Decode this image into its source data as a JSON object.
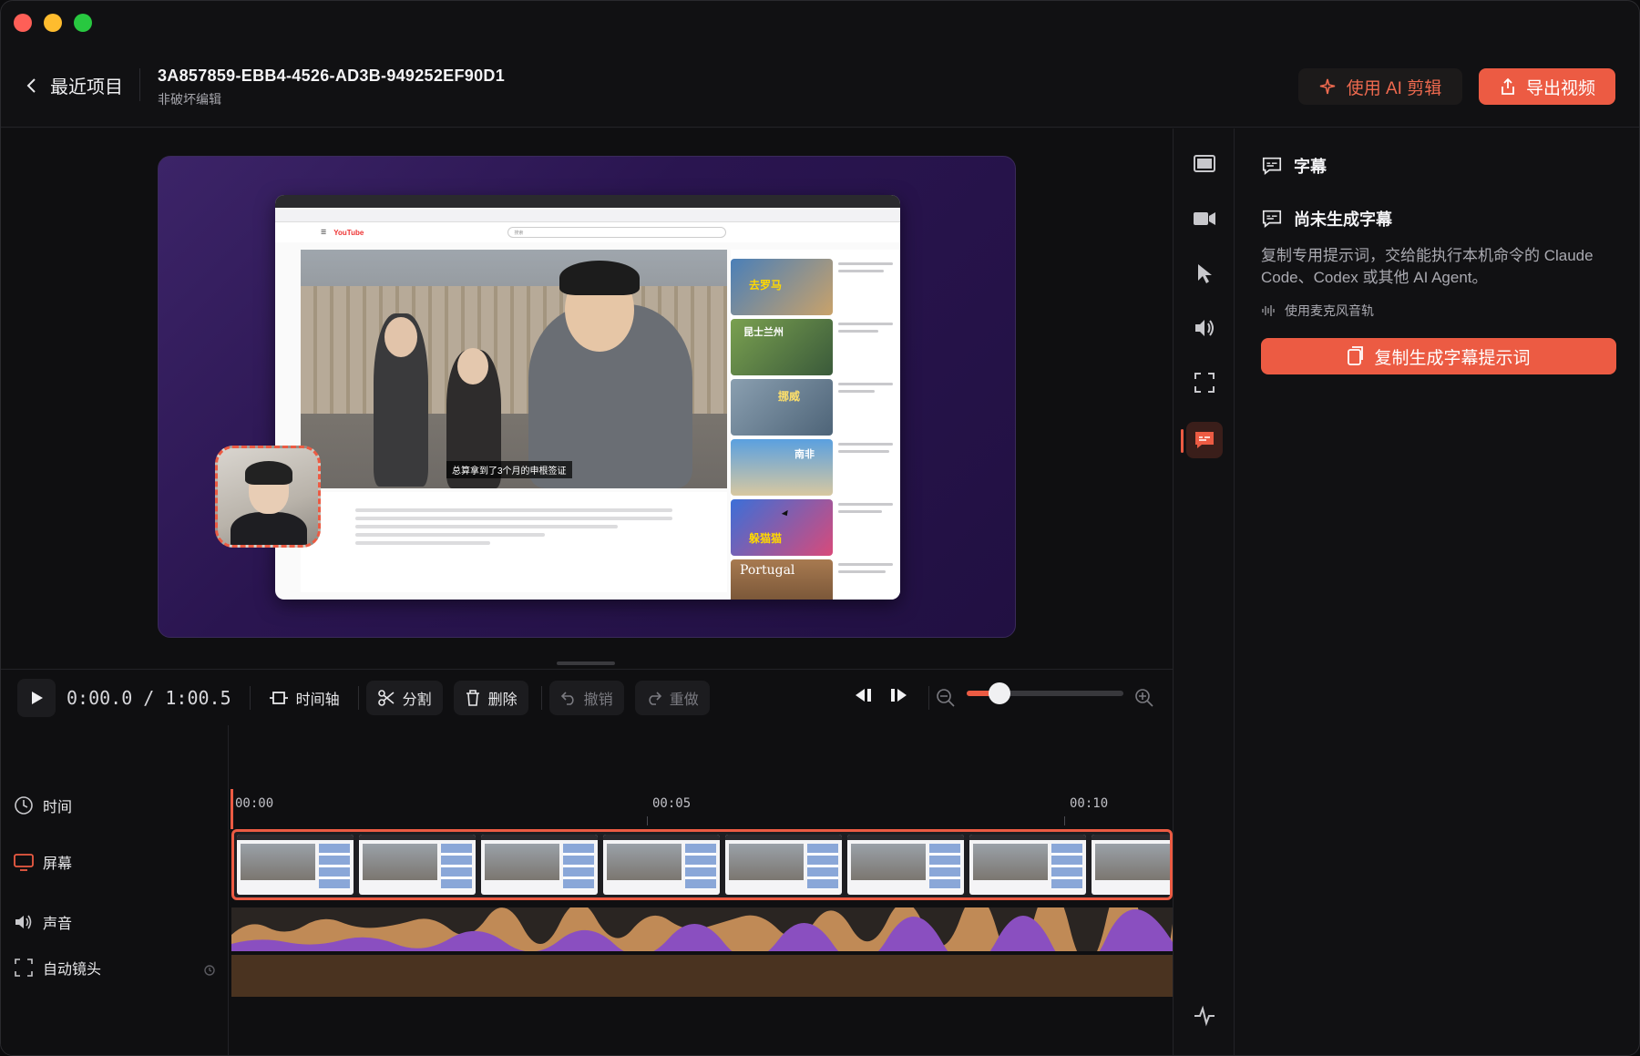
{
  "colors": {
    "accent": "#ec5b43",
    "close": "#fe5f57",
    "minimize": "#febc2e",
    "zoom": "#28c840"
  },
  "header": {
    "back_label": "最近项目",
    "project_title": "3A857859-EBB4-4526-AD3B-949252EF90D1",
    "project_subtitle": "非破坏编辑",
    "ai_edit_label": "使用 AI 剪辑",
    "export_label": "导出视频"
  },
  "preview": {
    "caption": "总算拿到了3个月的申根签证",
    "yt_logo": "YouTube",
    "search_placeholder": "搜索",
    "thumb_texts": [
      "去罗马",
      "昆士兰州",
      "挪威",
      "南非",
      "躲猫猫",
      "Portugal"
    ]
  },
  "toolbar": {
    "timecode": "0:00.0 / 1:00.5",
    "timeline_label": "时间轴",
    "split_label": "分割",
    "delete_label": "删除",
    "undo_label": "撤销",
    "redo_label": "重做",
    "zoom_level": 0.2
  },
  "timeline": {
    "ruler": [
      "00:00",
      "00:05",
      "00:10"
    ],
    "tracks": {
      "time": "时间",
      "screen": "屏幕",
      "audio": "声音",
      "auto_camera": "自动镜头"
    }
  },
  "panel": {
    "title": "字幕",
    "status": "尚未生成字幕",
    "description": "复制专用提示词，交给能执行本机命令的 Claude Code、Codex 或其他 AI Agent。",
    "mic_label": "使用麦克风音轨",
    "copy_button": "复制生成字幕提示词"
  }
}
